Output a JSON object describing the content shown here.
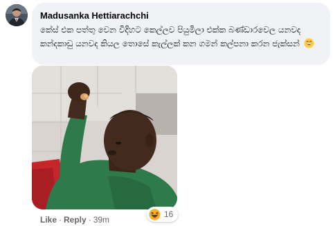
{
  "comment": {
    "author": "Madusanka Hettiarachchi",
    "text": "කේස් එක පත්තු වෙන විදිහට කෙල්ලව පියුමිලා එක්ක බණ්ඩාරවෙල යනවද කන්දකාඩු යනවද කියල තොසේ කැල්ලක් කන ගමන් කල්පනා කරන ජැක්සන්",
    "emoji_icon": "grinning-face-icon"
  },
  "photo": {
    "icon": "man-eating-photo"
  },
  "actions": {
    "like_label": "Like",
    "separator": "·",
    "reply_label": "Reply",
    "timestamp": "39m"
  },
  "reactions": {
    "icon": "haha-reaction-icon",
    "count": "16"
  },
  "colors": {
    "bubble_bg": "#f0f2f5",
    "meta_text": "#65676b",
    "name_text": "#050505",
    "haha_yellow": "#f7b125"
  }
}
